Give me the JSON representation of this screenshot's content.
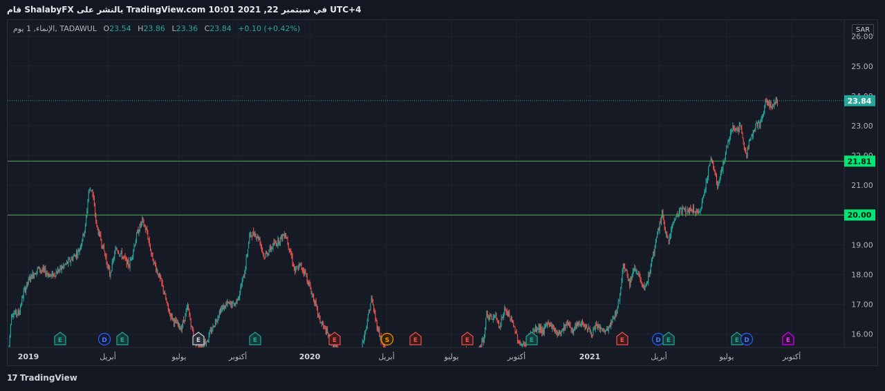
{
  "caption": "قام ShalabyFX بالنشر على TradingView.com  10:01 2021 ,22 في سبتمبر UTC+4",
  "legend": {
    "symbol": "الإنماء, 1 يوم, TADAWUL",
    "open_label": "O",
    "open": "23.54",
    "high_label": "H",
    "high": "23.86",
    "low_label": "L",
    "low": "23.36",
    "close_label": "C",
    "close": "23.84",
    "change": "+0.10 (+0.42%)"
  },
  "currency": "SAR",
  "footer": {
    "logo": "17",
    "brand": "TradingView"
  },
  "colors": {
    "background": "#161a25",
    "up": "#26a69a",
    "down": "#ef5350",
    "level_line": "#4caf50",
    "level_tag": "#00e676",
    "price_tag": "#26a69a",
    "last_price_line": "#26a69a"
  },
  "chart_data": {
    "type": "candlestick",
    "x_ticks": [
      {
        "label": "2019",
        "bold": true
      },
      {
        "label": "أبريل",
        "bold": false
      },
      {
        "label": "يوليو",
        "bold": false
      },
      {
        "label": "أكتوبر",
        "bold": false
      },
      {
        "label": "2020",
        "bold": true
      },
      {
        "label": "أبريل",
        "bold": false
      },
      {
        "label": "يوليو",
        "bold": false
      },
      {
        "label": "أكتوبر",
        "bold": false
      },
      {
        "label": "2021",
        "bold": true
      },
      {
        "label": "أبريل",
        "bold": false
      },
      {
        "label": "يوليو",
        "bold": false
      },
      {
        "label": "أكتوبر",
        "bold": false
      }
    ],
    "y_ticks": [
      "16.00",
      "17.00",
      "18.00",
      "19.00",
      "20.00",
      "21.00",
      "22.00",
      "23.00",
      "24.00",
      "25.00",
      "26.00"
    ],
    "ylim": [
      15.55,
      26.55
    ],
    "last_price": {
      "value": 23.84,
      "label": "23.84"
    },
    "levels": [
      {
        "value": 21.81,
        "label": "21.81"
      },
      {
        "value": 20.0,
        "label": "20.00"
      }
    ],
    "anchor_prices": [
      [
        0,
        15.6
      ],
      [
        3,
        16.7
      ],
      [
        12,
        16.7
      ],
      [
        18,
        17.4
      ],
      [
        26,
        17.9
      ],
      [
        36,
        18.2
      ],
      [
        44,
        18.1
      ],
      [
        52,
        17.95
      ],
      [
        64,
        18.2
      ],
      [
        76,
        18.5
      ],
      [
        86,
        18.8
      ],
      [
        94,
        19.6
      ],
      [
        98,
        20.8
      ],
      [
        102,
        20.9
      ],
      [
        108,
        19.6
      ],
      [
        116,
        18.9
      ],
      [
        124,
        18.0
      ],
      [
        132,
        18.9
      ],
      [
        140,
        18.6
      ],
      [
        148,
        18.3
      ],
      [
        158,
        19.4
      ],
      [
        164,
        19.8
      ],
      [
        170,
        19.4
      ],
      [
        176,
        18.6
      ],
      [
        184,
        18.0
      ],
      [
        190,
        17.5
      ],
      [
        196,
        16.8
      ],
      [
        204,
        16.4
      ],
      [
        212,
        16.2
      ],
      [
        220,
        16.9
      ],
      [
        228,
        15.8
      ],
      [
        236,
        15.6
      ],
      [
        244,
        15.8
      ],
      [
        252,
        16.3
      ],
      [
        260,
        16.8
      ],
      [
        268,
        17.0
      ],
      [
        278,
        17.0
      ],
      [
        284,
        17.4
      ],
      [
        290,
        18.1
      ],
      [
        296,
        19.3
      ],
      [
        302,
        19.4
      ],
      [
        308,
        19.2
      ],
      [
        314,
        18.6
      ],
      [
        320,
        18.8
      ],
      [
        326,
        19.0
      ],
      [
        334,
        19.2
      ],
      [
        340,
        19.4
      ],
      [
        346,
        18.8
      ],
      [
        352,
        18.1
      ],
      [
        358,
        18.3
      ],
      [
        364,
        18.1
      ],
      [
        370,
        17.6
      ],
      [
        376,
        17.1
      ],
      [
        382,
        16.5
      ],
      [
        388,
        16.2
      ],
      [
        394,
        15.9
      ],
      [
        400,
        15.6
      ],
      [
        420,
        15.0
      ],
      [
        432,
        15.3
      ],
      [
        440,
        16.3
      ],
      [
        446,
        17.2
      ],
      [
        452,
        16.4
      ],
      [
        458,
        15.8
      ],
      [
        468,
        15.1
      ],
      [
        480,
        15.2
      ],
      [
        500,
        14.9
      ],
      [
        520,
        14.8
      ],
      [
        540,
        15.0
      ],
      [
        556,
        15.3
      ],
      [
        568,
        15.5
      ],
      [
        576,
        15.2
      ],
      [
        580,
        15.6
      ],
      [
        584,
        15.8
      ],
      [
        588,
        16.7
      ],
      [
        592,
        16.5
      ],
      [
        598,
        16.6
      ],
      [
        604,
        16.3
      ],
      [
        610,
        16.8
      ],
      [
        616,
        16.6
      ],
      [
        622,
        16.2
      ],
      [
        628,
        15.7
      ],
      [
        634,
        15.6
      ],
      [
        640,
        15.9
      ],
      [
        646,
        16.1
      ],
      [
        652,
        16.2
      ],
      [
        658,
        16.1
      ],
      [
        664,
        16.4
      ],
      [
        670,
        16.2
      ],
      [
        676,
        16.0
      ],
      [
        682,
        16.2
      ],
      [
        688,
        16.4
      ],
      [
        694,
        16.1
      ],
      [
        700,
        16.3
      ],
      [
        706,
        16.4
      ],
      [
        712,
        16.2
      ],
      [
        718,
        16.0
      ],
      [
        724,
        16.3
      ],
      [
        730,
        16.1
      ],
      [
        736,
        16.1
      ],
      [
        742,
        16.4
      ],
      [
        748,
        16.8
      ],
      [
        752,
        17.3
      ],
      [
        756,
        18.4
      ],
      [
        760,
        18.1
      ],
      [
        764,
        17.7
      ],
      [
        768,
        18.1
      ],
      [
        772,
        18.2
      ],
      [
        776,
        17.9
      ],
      [
        780,
        17.5
      ],
      [
        784,
        17.6
      ],
      [
        788,
        18.0
      ],
      [
        792,
        18.6
      ],
      [
        796,
        19.0
      ],
      [
        800,
        19.6
      ],
      [
        804,
        20.1
      ],
      [
        808,
        19.3
      ],
      [
        812,
        19.2
      ],
      [
        816,
        19.6
      ],
      [
        820,
        19.9
      ],
      [
        824,
        20.1
      ],
      [
        830,
        20.2
      ],
      [
        836,
        20.1
      ],
      [
        842,
        20.2
      ],
      [
        848,
        20.0
      ],
      [
        852,
        20.3
      ],
      [
        856,
        20.8
      ],
      [
        860,
        21.4
      ],
      [
        864,
        21.9
      ],
      [
        868,
        21.5
      ],
      [
        872,
        21.0
      ],
      [
        876,
        21.4
      ],
      [
        880,
        21.8
      ],
      [
        884,
        22.3
      ],
      [
        888,
        22.8
      ],
      [
        892,
        23.0
      ],
      [
        896,
        22.8
      ],
      [
        900,
        23.0
      ],
      [
        904,
        22.4
      ],
      [
        908,
        22.0
      ],
      [
        912,
        22.5
      ],
      [
        916,
        22.9
      ],
      [
        920,
        23.1
      ],
      [
        924,
        23.0
      ],
      [
        928,
        23.4
      ],
      [
        932,
        23.9
      ],
      [
        936,
        23.7
      ],
      [
        940,
        23.6
      ],
      [
        944,
        23.9
      ],
      [
        946,
        23.84
      ]
    ],
    "events": [
      {
        "letter": "E",
        "type": "earnings-green"
      },
      {
        "letter": "D",
        "type": "dividend"
      },
      {
        "letter": "E",
        "type": "earnings-green"
      },
      {
        "letter": "E",
        "type": "earnings-gray"
      },
      {
        "letter": "E",
        "type": "earnings-green"
      },
      {
        "letter": "E",
        "type": "earnings-red"
      },
      {
        "letter": "S",
        "type": "split"
      },
      {
        "letter": "E",
        "type": "earnings-red"
      },
      {
        "letter": "E",
        "type": "earnings-red"
      },
      {
        "letter": "E",
        "type": "earnings-green"
      },
      {
        "letter": "E",
        "type": "earnings-red"
      },
      {
        "letter": "D",
        "type": "dividend"
      },
      {
        "letter": "E",
        "type": "earnings-green"
      },
      {
        "letter": "E",
        "type": "earnings-green"
      },
      {
        "letter": "D",
        "type": "dividend"
      },
      {
        "letter": "E",
        "type": "earnings-purple"
      }
    ]
  }
}
